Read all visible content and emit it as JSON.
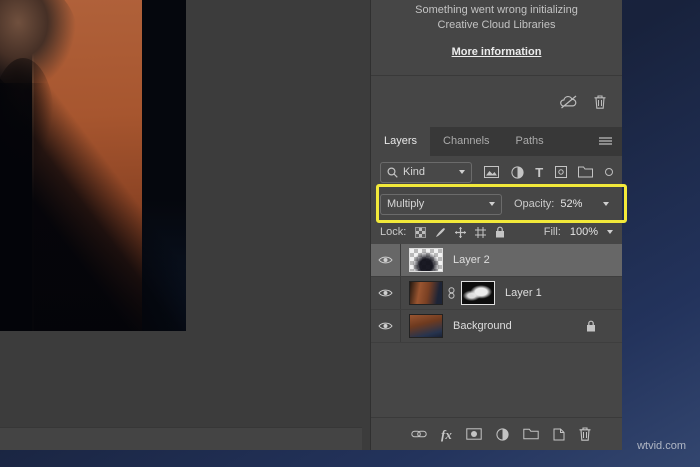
{
  "desktop": {
    "watermark": "wtvid.com"
  },
  "panel": {
    "error": {
      "line1": "Something went wrong initializing",
      "line2": "Creative Cloud Libraries",
      "link_label": "More information"
    },
    "tabs": [
      {
        "label": "Layers",
        "active": true
      },
      {
        "label": "Channels",
        "active": false
      },
      {
        "label": "Paths",
        "active": false
      }
    ],
    "filter": {
      "kind_label": "Kind",
      "type_icon_label": "T"
    },
    "blend": {
      "mode": "Multiply",
      "opacity_label": "Opacity:",
      "opacity_value": "52%"
    },
    "lock": {
      "label": "Lock:",
      "fill_label": "Fill:",
      "fill_value": "100%"
    },
    "layers": [
      {
        "name": "Layer 2"
      },
      {
        "name": "Layer 1"
      },
      {
        "name": "Background"
      }
    ],
    "toolbar": {
      "fx_label": "fx"
    },
    "highlight_color": "#f2e93a"
  }
}
